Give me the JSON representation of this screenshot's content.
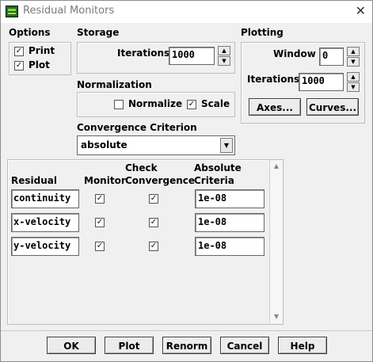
{
  "window": {
    "title": "Residual Monitors"
  },
  "options": {
    "label": "Options",
    "print_label": "Print",
    "plot_label": "Plot"
  },
  "storage": {
    "label": "Storage",
    "iterations_label": "Iterations",
    "iterations_value": "1000"
  },
  "plotting": {
    "label": "Plotting",
    "window_label": "Window",
    "window_value": "0",
    "iterations_label": "Iterations",
    "iterations_value": "1000",
    "axes_button": "Axes...",
    "curves_button": "Curves..."
  },
  "normalization": {
    "label": "Normalization",
    "normalize_label": "Normalize",
    "scale_label": "Scale"
  },
  "convergence": {
    "label": "Convergence Criterion",
    "selected": "absolute"
  },
  "table": {
    "headers": {
      "residual": "Residual",
      "monitor": "Monitor",
      "check": "Check",
      "convergence": "Convergence",
      "absolute": "Absolute",
      "criteria": "Criteria"
    },
    "rows": [
      {
        "name": "continuity",
        "criteria": "1e-08"
      },
      {
        "name": "x-velocity",
        "criteria": "1e-08"
      },
      {
        "name": "y-velocity",
        "criteria": "1e-08"
      }
    ]
  },
  "buttons": {
    "ok": "OK",
    "plot": "Plot",
    "renorm": "Renorm",
    "cancel": "Cancel",
    "help": "Help"
  }
}
